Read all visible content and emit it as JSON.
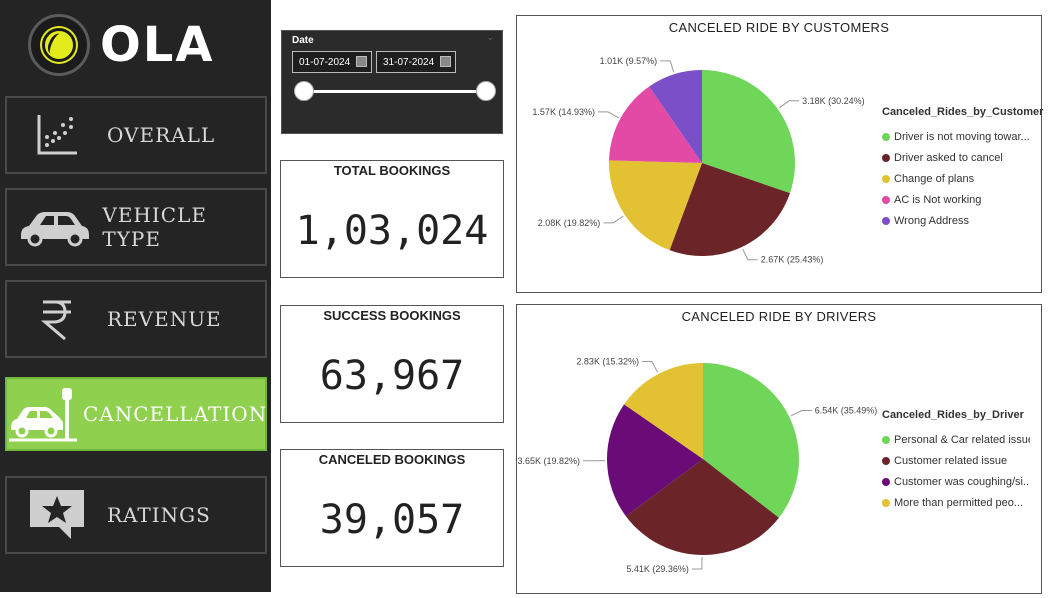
{
  "brand": {
    "name": "OLA"
  },
  "nav": [
    {
      "id": "overall",
      "label": "OVERALL",
      "icon": "scatter-chart-icon",
      "active": false
    },
    {
      "id": "vehicle",
      "label": "VEHICLE TYPE",
      "icon": "car-icon",
      "active": false
    },
    {
      "id": "revenue",
      "label": "REVENUE",
      "icon": "rupee-icon",
      "active": false
    },
    {
      "id": "cancellation",
      "label": "CANCELLATION",
      "icon": "car-crash-icon",
      "active": true
    },
    {
      "id": "ratings",
      "label": "RATINGS",
      "icon": "star-chat-icon",
      "active": false
    }
  ],
  "slicer": {
    "label": "Date",
    "start": "01-07-2024",
    "end": "31-07-2024"
  },
  "kpis": {
    "total": {
      "title": "TOTAL BOOKINGS",
      "value": "1,03,024"
    },
    "success": {
      "title": "SUCCESS BOOKINGS",
      "value": "63,967"
    },
    "canceled": {
      "title": "CANCELED BOOKINGS",
      "value": "39,057"
    }
  },
  "chart_data": [
    {
      "type": "pie",
      "title": "CANCELED RIDE BY CUSTOMERS",
      "legend_title": "Canceled_Rides_by_Customer",
      "legend_position": "right",
      "slices": [
        {
          "name": "Driver is not moving towar...",
          "value": 3180,
          "label": "3.18K (30.24%)",
          "color": "#6fd65a"
        },
        {
          "name": "Driver asked to cancel",
          "value": 2670,
          "label": "2.67K (25.43%)",
          "color": "#6b2428"
        },
        {
          "name": "Change of plans",
          "value": 2080,
          "label": "2.08K (19.82%)",
          "color": "#e2c233"
        },
        {
          "name": "AC is Not working",
          "value": 1570,
          "label": "1.57K (14.93%)",
          "color": "#e24aa6"
        },
        {
          "name": "Wrong Address",
          "value": 1010,
          "label": "1.01K (9.57%)",
          "color": "#7a4fc8"
        }
      ]
    },
    {
      "type": "pie",
      "title": "CANCELED RIDE BY DRIVERS",
      "legend_title": "Canceled_Rides_by_Driver",
      "legend_position": "right",
      "slices": [
        {
          "name": "Personal & Car related issue",
          "value": 6540,
          "label": "6.54K (35.49%)",
          "color": "#6fd65a"
        },
        {
          "name": "Customer related issue",
          "value": 5410,
          "label": "5.41K (29.36%)",
          "color": "#6b2428"
        },
        {
          "name": "Customer was coughing/si...",
          "value": 3650,
          "label": "3.65K (19.82%)",
          "color": "#6a0b78"
        },
        {
          "name": "More than permitted peo...",
          "value": 2830,
          "label": "2.83K (15.32%)",
          "color": "#e2c233"
        }
      ]
    }
  ]
}
